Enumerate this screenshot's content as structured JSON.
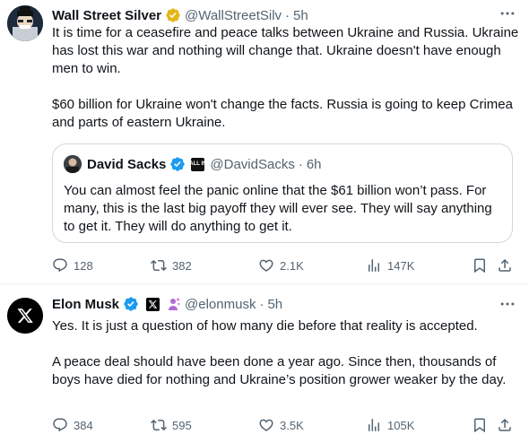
{
  "post1": {
    "display_name": "Wall Street Silver",
    "handle": "@WallStreetSilv",
    "separator": "·",
    "time": "5h",
    "more_icon": "more-horizontal-icon",
    "paragraphs": [
      "It is time for a ceasefire and peace talks between Ukraine and Russia. Ukraine has lost this war and nothing will change that. Ukraine doesn't have enough men to win.",
      "$60 billion for Ukraine won't change the facts. Russia is going to keep Crimea and parts of eastern Ukraine."
    ],
    "quote": {
      "display_name": "David Sacks",
      "affiliation_badge": "ALL IN",
      "handle": "@DavidSacks",
      "separator": "·",
      "time": "6h",
      "text": "You can almost feel the panic online that the $61 billion won’t pass. For many, this is the last big payoff they will ever see. They will say anything to get it. They will do anything to get it."
    },
    "actions": {
      "replies": "128",
      "reposts": "382",
      "likes": "2.1K",
      "views": "147K"
    }
  },
  "post2": {
    "display_name": "Elon Musk",
    "handle": "@elonmusk",
    "separator": "·",
    "time": "5h",
    "more_icon": "more-horizontal-icon",
    "paragraphs": [
      "Yes. It is just a question of how many die before that reality is accepted.",
      "A peace deal should have been done a year ago. Since then, thousands of boys have died for nothing and Ukraine’s position grower weaker by the day."
    ],
    "actions": {
      "replies": "384",
      "reposts": "595",
      "likes": "3.5K",
      "views": "105K"
    }
  },
  "colors": {
    "text": "#0f1419",
    "secondary": "#536471",
    "border": "#cfd9de",
    "gold_badge": "#e2b719",
    "blue_badge": "#1d9bf0"
  }
}
